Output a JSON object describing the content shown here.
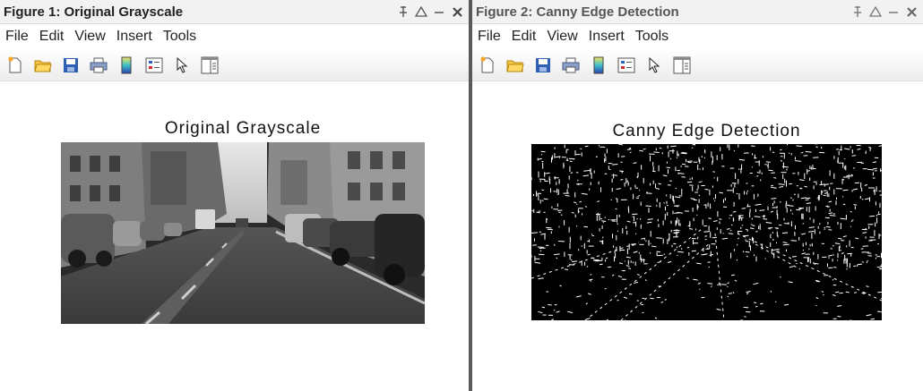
{
  "figures": [
    {
      "window_title": "Figure 1: Original Grayscale",
      "menu": [
        "File",
        "Edit",
        "View",
        "Insert",
        "Tools"
      ],
      "toolbar": [
        "new-figure-icon",
        "open-file-icon",
        "save-icon",
        "print-icon",
        "colorbar-icon",
        "legend-icon",
        "pointer-icon",
        "property-editor-icon"
      ],
      "axes_title": "Original Grayscale",
      "image": "grayscale street scene photo"
    },
    {
      "window_title": "Figure 2: Canny Edge Detection",
      "menu": [
        "File",
        "Edit",
        "View",
        "Insert",
        "Tools"
      ],
      "toolbar": [
        "new-figure-icon",
        "open-file-icon",
        "save-icon",
        "print-icon",
        "colorbar-icon",
        "legend-icon",
        "pointer-icon",
        "property-editor-icon"
      ],
      "axes_title": "Canny Edge Detection",
      "image": "binary edge map"
    }
  ],
  "window_controls": [
    "pin-icon",
    "dock-icon",
    "minimize-icon",
    "close-icon"
  ],
  "colors": {
    "titlebar": "#f2f2f2",
    "image_bg": "#000000",
    "divider": "#5a5a5a"
  }
}
